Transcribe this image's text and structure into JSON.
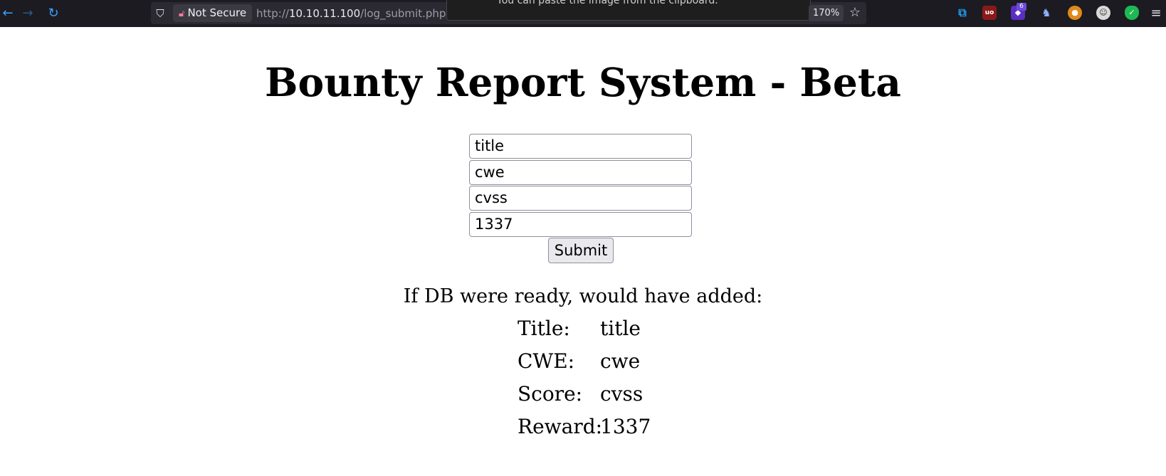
{
  "browser": {
    "security_label": "Not Secure",
    "url_prefix": "http://",
    "url_host": "10.10.11.100",
    "url_path": "/log_submit.php",
    "toast_text": "You can paste the image from the clipboard.",
    "zoom": "170%",
    "extension_badge": "6",
    "icons": [
      "back-icon",
      "forward-icon",
      "reload-icon",
      "shield-icon",
      "lock-icon",
      "bookmark-star-icon",
      "menu-icon"
    ]
  },
  "page": {
    "title": "Bounty Report System - Beta",
    "form": {
      "title_value": "title",
      "cwe_value": "cwe",
      "cvss_value": "cvss",
      "reward_value": "1337",
      "submit_label": "Submit"
    },
    "result": {
      "heading": "If DB were ready, would have added:",
      "rows": [
        {
          "label": "Title:",
          "value": "title"
        },
        {
          "label": "CWE:",
          "value": "cwe"
        },
        {
          "label": "Score:",
          "value": "cvss"
        },
        {
          "label": "Reward:",
          "value": "1337"
        }
      ]
    }
  }
}
